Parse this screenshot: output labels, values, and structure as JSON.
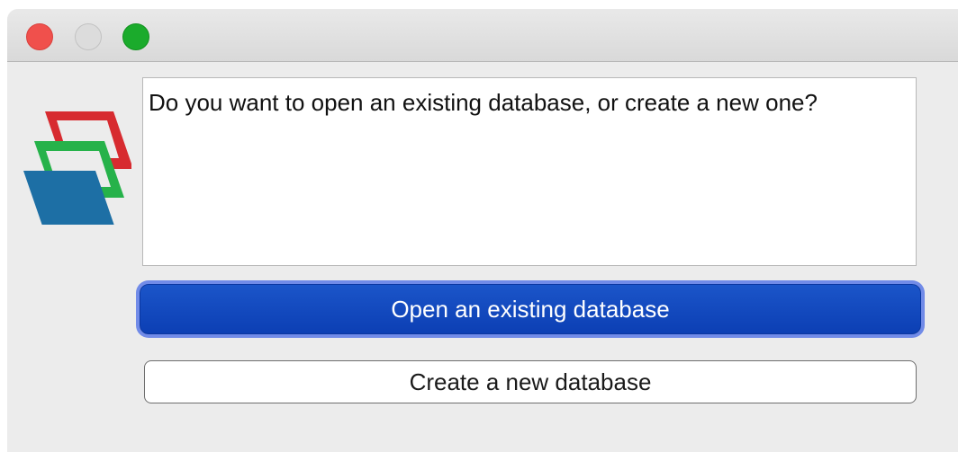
{
  "dialog": {
    "message": "Do you want to open an existing database, or create a new one?",
    "open_button_label": "Open an existing database",
    "create_button_label": "Create a new database"
  },
  "icons": {
    "app_logo": "database-layers-icon",
    "logo_colors": [
      "#d72b30",
      "#26b24a",
      "#1d6fa5"
    ]
  },
  "window_controls": {
    "close_color": "#f0504c",
    "minimize_color": "#dcdcdc",
    "zoom_color": "#1bab2c"
  },
  "colors": {
    "accent": "#0c3fb4",
    "focus_ring": "#5c7ae8"
  }
}
